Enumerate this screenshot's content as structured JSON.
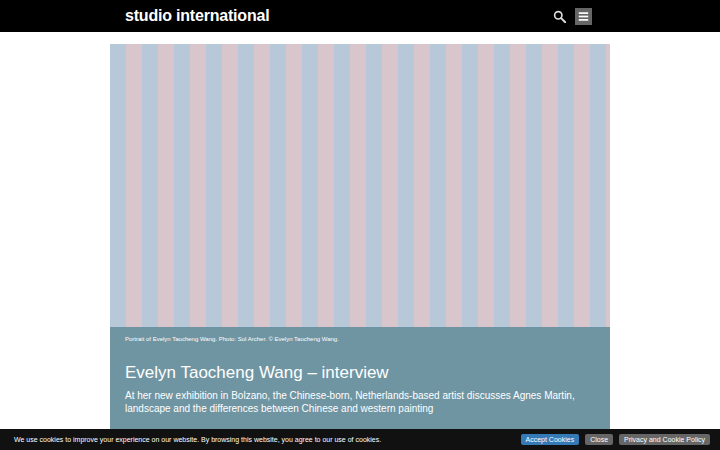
{
  "header": {
    "logo": "studio international"
  },
  "article": {
    "photo_caption": "Portrait of Evelyn Taocheng Wang. Photo: Sol Archer. © Evelyn Taocheng Wang.",
    "title": "Evelyn Taocheng Wang – interview",
    "standfirst": "At her new exhibition in Bolzano, the Chinese-born, Netherlands-based artist discusses Agnes Martin, landscape and the differences between Chinese and western painting"
  },
  "cookie_bar": {
    "message": "We use cookies to improve your experience on our website. By browsing this website, you agree to our use of cookies.",
    "buttons": [
      {
        "label": "Accept Cookies",
        "kind": "primary"
      },
      {
        "label": "Close",
        "kind": "secondary"
      },
      {
        "label": "Privacy and Cookie Policy",
        "kind": "secondary"
      }
    ]
  }
}
